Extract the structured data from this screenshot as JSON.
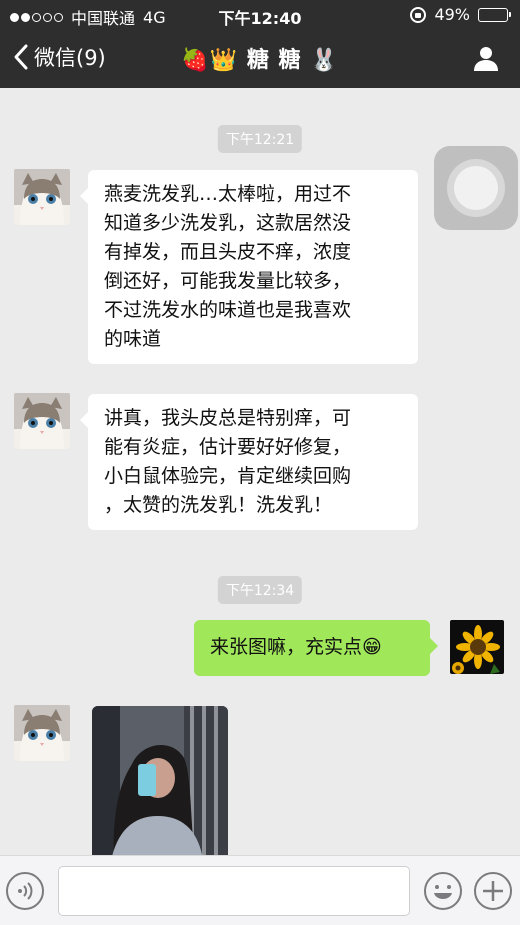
{
  "status": {
    "carrier": "中国联通",
    "network": "4G",
    "time": "下午12:40",
    "battery": "49%",
    "battery_level": 0.49,
    "signal_bars": 2
  },
  "header": {
    "back_label": "微信(9)",
    "title_prefix": "🍓👑",
    "title": "糖 糖",
    "title_suffix": "🐰"
  },
  "messages": {
    "stamp1": "下午12:21",
    "m1": [
      "燕麦洗发乳…太棒啦，用过不",
      "知道多少洗发乳，这款居然没",
      "有掉发，而且头皮不痒，浓度",
      "倒还好，可能我发量比较多，",
      "不过洗发水的味道也是我喜欢",
      "的味道"
    ],
    "m2": [
      "讲真，我头皮总是特别痒，可",
      "能有炎症，估计要好好修复，",
      "小白鼠体验完，肯定继续回购",
      "，太赞的洗发乳！洗发乳！"
    ],
    "stamp2": "下午12:34",
    "m3": "来张图嘛，充实点😁"
  },
  "icons": [
    "back-chevron-icon",
    "profile-icon",
    "cat-avatar",
    "sunflower-avatar",
    "assistive-touch-icon",
    "voice-icon",
    "emoji-icon",
    "plus-icon"
  ],
  "colors": {
    "header_bg": "#2e2e2e",
    "chat_bg": "#ebebeb",
    "sent_bubble": "#a0e75a",
    "received_bubble": "#ffffff"
  }
}
